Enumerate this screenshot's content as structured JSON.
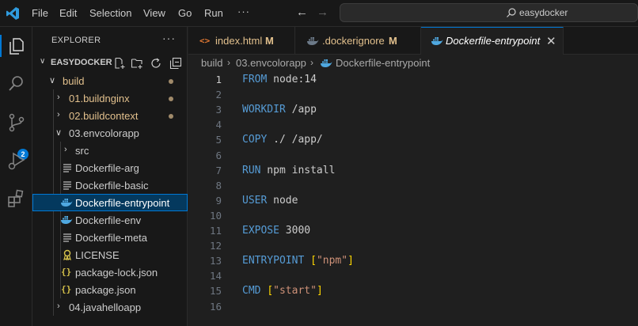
{
  "menu": {
    "items": [
      "File",
      "Edit",
      "Selection",
      "View",
      "Go",
      "Run"
    ],
    "more": "···"
  },
  "command_center": {
    "label": "easydocker",
    "icon": "search-icon"
  },
  "activity_bar": {
    "items": [
      "explorer-icon",
      "search-icon",
      "source-control-icon",
      "run-debug-icon",
      "extensions-icon"
    ],
    "scm_badge": "2"
  },
  "sidebar": {
    "title": "EXPLORER",
    "more": "···",
    "section": "EASYDOCKER",
    "tree": [
      {
        "label": "build",
        "type": "folder-open",
        "modified": true
      },
      {
        "label": "01.buildnginx",
        "type": "folder",
        "modified": true
      },
      {
        "label": "02.buildcontext",
        "type": "folder",
        "modified": true
      },
      {
        "label": "03.envcolorapp",
        "type": "folder-open",
        "modified": false
      },
      {
        "label": "src",
        "type": "folder",
        "modified": false
      },
      {
        "label": "Dockerfile-arg",
        "type": "lines-file",
        "modified": false
      },
      {
        "label": "Dockerfile-basic",
        "type": "lines-file",
        "modified": false
      },
      {
        "label": "Dockerfile-entrypoint",
        "type": "docker-file",
        "modified": false
      },
      {
        "label": "Dockerfile-env",
        "type": "docker-file",
        "modified": false
      },
      {
        "label": "Dockerfile-meta",
        "type": "lines-file",
        "modified": false
      },
      {
        "label": "LICENSE",
        "type": "license-file",
        "modified": false
      },
      {
        "label": "package-lock.json",
        "type": "json-file",
        "modified": false
      },
      {
        "label": "package.json",
        "type": "json-file",
        "modified": false
      },
      {
        "label": "04.javahelloapp",
        "type": "folder",
        "modified": false
      }
    ]
  },
  "tabs": [
    {
      "label": "index.html",
      "modified_marker": "M",
      "icon": "html-icon"
    },
    {
      "label": ".dockerignore",
      "modified_marker": "M",
      "icon": "docker-icon"
    },
    {
      "label": "Dockerfile-entrypoint",
      "modified_marker": "",
      "icon": "docker-icon",
      "active": true
    }
  ],
  "breadcrumb": [
    "build",
    "03.envcolorapp",
    "Dockerfile-entrypoint"
  ],
  "editor": {
    "current_line": 1,
    "lines": [
      {
        "n": "1",
        "kw": "FROM",
        "rest": " node:14"
      },
      {
        "n": "2"
      },
      {
        "n": "3",
        "kw": "WORKDIR",
        "rest": " /app"
      },
      {
        "n": "4"
      },
      {
        "n": "5",
        "kw": "COPY",
        "rest": " ./ /app/"
      },
      {
        "n": "6"
      },
      {
        "n": "7",
        "kw": "RUN",
        "rest": " npm install"
      },
      {
        "n": "8"
      },
      {
        "n": "9",
        "kw": "USER",
        "rest": " node"
      },
      {
        "n": "10"
      },
      {
        "n": "11",
        "kw": "EXPOSE",
        "rest": " 3000"
      },
      {
        "n": "12"
      },
      {
        "n": "13",
        "kw": "ENTRYPOINT",
        "arr": "\"npm\""
      },
      {
        "n": "14"
      },
      {
        "n": "15",
        "kw": "CMD",
        "arr": "\"start\""
      },
      {
        "n": "16"
      }
    ]
  },
  "colors": {
    "accent": "#0078d4",
    "keyword": "#569cd6",
    "string": "#ce9178",
    "modified": "#e2c08d",
    "docker": "#4fa8e0"
  }
}
